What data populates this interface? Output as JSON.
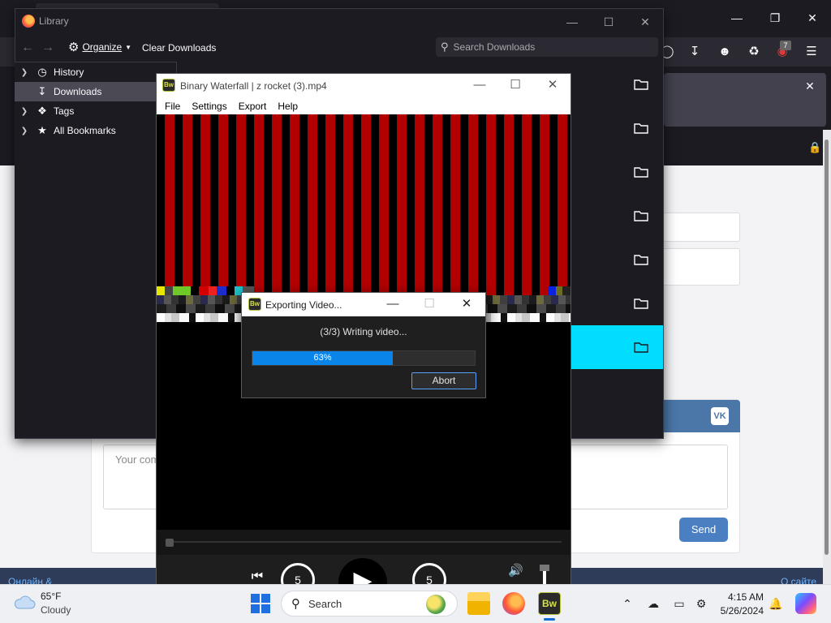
{
  "library": {
    "title": "Library",
    "toolbar": {
      "organize_label": "Organize",
      "clear_label": "Clear Downloads",
      "search_placeholder": "Search Downloads"
    },
    "tree": [
      {
        "label": "History"
      },
      {
        "label": "Downloads"
      },
      {
        "label": "Tags"
      },
      {
        "label": "All Bookmarks"
      }
    ]
  },
  "binary_waterfall": {
    "title": "Binary Waterfall | z rocket (3).mp4",
    "icon_text": "Bw",
    "menu": [
      "File",
      "Settings",
      "Export",
      "Help"
    ],
    "rewind_seconds": "5",
    "forward_seconds": "5"
  },
  "export_dialog": {
    "title": "Exporting Video...",
    "status": "(3/3) Writing video...",
    "progress_percent": 63,
    "progress_label": "63%",
    "abort_label": "Abort"
  },
  "webpage": {
    "comment_placeholder": "Your com",
    "send_label": "Send",
    "vk_logo": "VK",
    "footer_left": "Онлайн &",
    "footer_right": "О сайте",
    "extension_badge": "7"
  },
  "taskbar": {
    "weather_temp": "65°F",
    "weather_condition": "Cloudy",
    "search_label": "Search",
    "time": "4:15 AM",
    "date": "5/26/2024",
    "bw_app_text": "Bw"
  },
  "colors": {
    "accent_blue": "#0a84e8",
    "waterfall_red": "#b20000",
    "selected_cyan": "#00ddff"
  }
}
